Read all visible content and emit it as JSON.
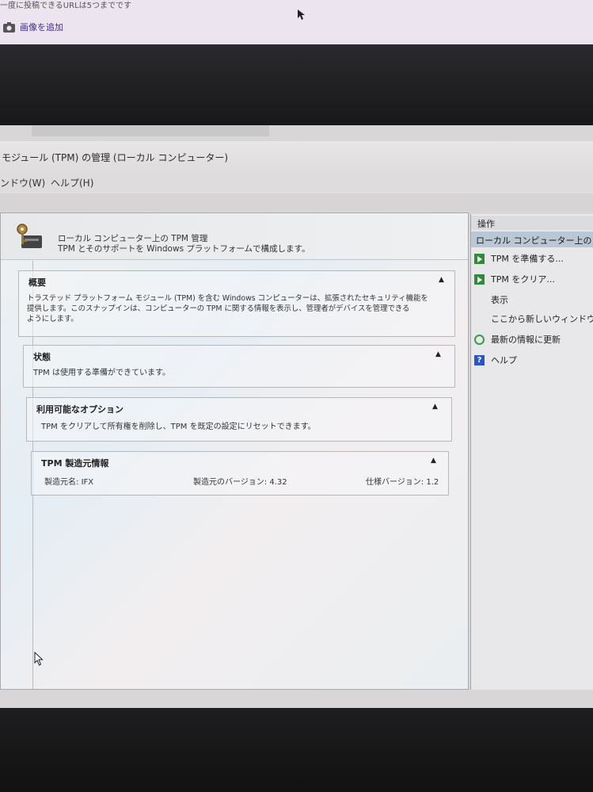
{
  "browser": {
    "note": "一度に投稿できるURLは5つまでです",
    "add_image": "画像を追加"
  },
  "window": {
    "title": "モジュール (TPM) の管理 (ローカル コンピューター)"
  },
  "menu": {
    "items": [
      "ンドウ(W)",
      "ヘルプ(H)"
    ]
  },
  "header": {
    "title": "ローカル コンピューター上の TPM 管理",
    "description": "TPM とそのサポートを Windows プラットフォームで構成します。"
  },
  "panels": {
    "overview": {
      "title": "概要",
      "body_line1": "トラステッド プラットフォーム モジュール (TPM) を含む Windows コンピューターは、拡張されたセキュリティ機能を",
      "body_line2": "提供します。このスナップインは、コンピューターの TPM に関する情報を表示し、管理者がデバイスを管理できる",
      "body_line3": "ようにします。"
    },
    "status": {
      "title": "状態",
      "body": "TPM は使用する準備ができています。"
    },
    "options": {
      "title": "利用可能なオプション",
      "body": "TPM をクリアして所有権を削除し、TPM を既定の設定にリセットできます。"
    },
    "manufacturer": {
      "title": "TPM 製造元情報",
      "name_label": "製造元名:",
      "name_value": "IFX",
      "version_label": "製造元のバージョン:",
      "version_value": "4.32",
      "spec_label": "仕様バージョン:",
      "spec_value": "1.2"
    }
  },
  "actions": {
    "header": "操作",
    "subheader": "ローカル コンピューター上の TPM 管理",
    "items": {
      "prepare": "TPM を準備する...",
      "clear": "TPM をクリア...",
      "view": "表示",
      "new_window": "ここから新しいウィンドウ",
      "refresh": "最新の情報に更新",
      "help": "ヘルプ"
    }
  },
  "colors": {
    "selection": "#b9c7d6",
    "action_icon_green": "#2f8a3a",
    "help_icon_blue": "#2a55c8"
  }
}
